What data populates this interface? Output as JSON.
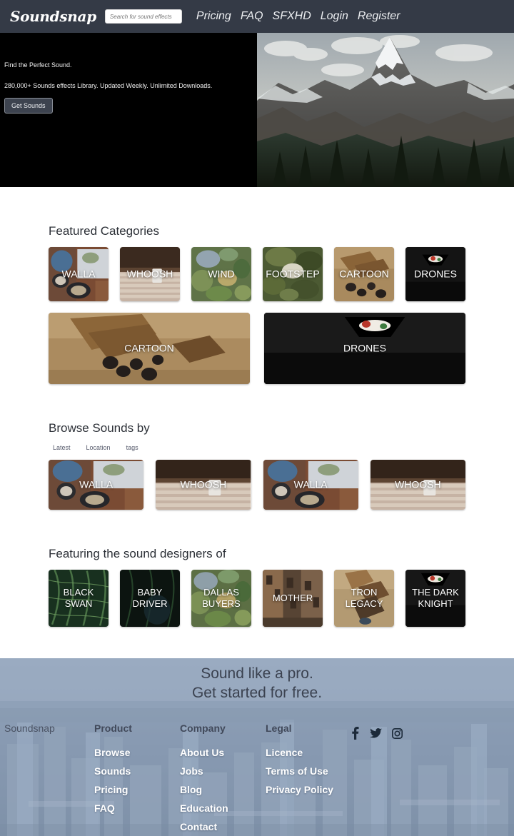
{
  "brand": {
    "name": "Soundsnap"
  },
  "nav": {
    "search": {
      "placeholder": "Search for sound effects",
      "value": ""
    },
    "links": [
      {
        "label": "Pricing",
        "name": "nav-link-pricing"
      },
      {
        "label": "FAQ",
        "name": "nav-link-faq"
      },
      {
        "label": "SFXHD",
        "name": "nav-link-sfxhd"
      },
      {
        "label": "Login",
        "name": "nav-link-login"
      },
      {
        "label": "Register",
        "name": "nav-link-register"
      }
    ]
  },
  "hero": {
    "title": "Find the Perfect Sound.",
    "subtitle": "280,000+ Sounds effects Library. Updated Weekly. Unlimited Downloads.",
    "cta_label": "Get Sounds",
    "background_color": "#000000"
  },
  "featured": {
    "title": "Featured Categories",
    "cards": [
      {
        "label": "WALLA"
      },
      {
        "label": "WHOOSH"
      },
      {
        "label": "WIND"
      },
      {
        "label": "FOOTSTEP"
      },
      {
        "label": "CARTOON"
      },
      {
        "label": "DRONES"
      }
    ],
    "wide_cards": [
      {
        "label": "CARTOON"
      },
      {
        "label": "DRONES"
      }
    ]
  },
  "browse": {
    "title": "Browse Sounds by",
    "tabs": [
      {
        "label": "Latest"
      },
      {
        "label": "Location"
      },
      {
        "label": "tags"
      }
    ],
    "cards": [
      {
        "label": "WALLA"
      },
      {
        "label": "WHOOSH"
      },
      {
        "label": "WALLA"
      },
      {
        "label": "WHOOSH"
      }
    ]
  },
  "designers": {
    "title": "Featuring the sound designers of",
    "cards": [
      {
        "label": "BLACK SWAN"
      },
      {
        "label": "BABY DRIVER"
      },
      {
        "label": "DALLAS BUYERS"
      },
      {
        "label": "MOTHER"
      },
      {
        "label": "TRON LEGACY"
      },
      {
        "label": "THE DARK KNIGHT"
      }
    ]
  },
  "footer": {
    "cta_line1": "Sound like a pro.",
    "cta_line2": "Get started for free.",
    "brand_heading": "Soundsnap",
    "columns": [
      {
        "heading": "Product",
        "links": [
          "Browse",
          "Sounds",
          "Pricing",
          "FAQ"
        ]
      },
      {
        "heading": "Company",
        "links": [
          "About Us",
          "Jobs",
          "Blog",
          "Education",
          "Contact"
        ]
      },
      {
        "heading": "Legal",
        "links": [
          "Licence",
          "Terms of Use",
          "Privacy Policy"
        ]
      }
    ],
    "social": [
      {
        "name": "facebook-icon"
      },
      {
        "name": "twitter-icon"
      },
      {
        "name": "instagram-icon"
      }
    ]
  },
  "colors": {
    "nav_bg": "#343a46",
    "hero_bg": "#000000",
    "footer_bg": "#8fa2bb",
    "link_white": "#ffffff",
    "heading_dark": "#2b2f36"
  }
}
